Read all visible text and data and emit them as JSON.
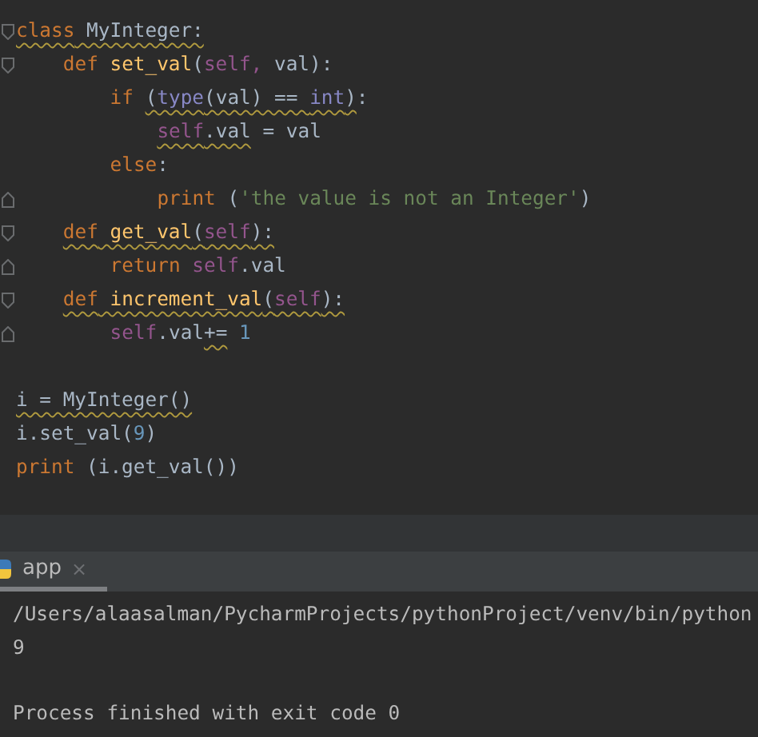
{
  "editor": {
    "lines": [
      {
        "kind": "code",
        "fold_start": true,
        "tokens": [
          {
            "text": "class",
            "kind": "keyword",
            "warning": true
          },
          {
            "text": " MyInteger:",
            "kind": "plain",
            "warning": true
          }
        ],
        "children": [
          {
            "kind": "code",
            "fold_start": true,
            "tokens": [
              {
                "text": "def",
                "kind": "keyword"
              },
              {
                "text": " set_val",
                "kind": "function"
              },
              {
                "text": "(",
                "kind": "plain"
              },
              {
                "text": "self,",
                "kind": "self"
              },
              {
                "text": " val):",
                "kind": "plain"
              }
            ],
            "children": [
              {
                "kind": "code",
                "tokens": [
                  {
                    "text": "if ",
                    "kind": "keyword"
                  },
                  {
                    "text": "(",
                    "kind": "plain",
                    "warning": true
                  },
                  {
                    "text": "type",
                    "kind": "builtin",
                    "warning": true
                  },
                  {
                    "text": "(val) == ",
                    "kind": "plain",
                    "warning": true
                  },
                  {
                    "text": "int",
                    "kind": "builtin",
                    "warning": true
                  },
                  {
                    "text": ")",
                    "kind": "plain",
                    "warning": true
                  },
                  {
                    "text": ":",
                    "kind": "plain"
                  }
                ],
                "children": [
                  {
                    "kind": "code",
                    "tokens": [
                      {
                        "text": "self",
                        "kind": "self",
                        "warning": true
                      },
                      {
                        "text": ".val",
                        "kind": "plain",
                        "warning": true
                      },
                      {
                        "text": " = val",
                        "kind": "plain"
                      }
                    ]
                  }
                ]
              },
              {
                "kind": "code",
                "tokens": [
                  {
                    "text": "else",
                    "kind": "keyword"
                  },
                  {
                    "text": ":",
                    "kind": "plain"
                  }
                ],
                "children": [
                  {
                    "kind": "code",
                    "fold_end": true,
                    "tokens": [
                      {
                        "text": "print",
                        "kind": "keyword"
                      },
                      {
                        "text": " (",
                        "kind": "plain"
                      },
                      {
                        "text": "'the value is not an Integer'",
                        "kind": "string"
                      },
                      {
                        "text": ")",
                        "kind": "plain"
                      }
                    ]
                  }
                ]
              }
            ]
          },
          {
            "kind": "code",
            "fold_start": true,
            "tokens": [
              {
                "text": "def",
                "kind": "keyword",
                "warning": true
              },
              {
                "text": " get_val",
                "kind": "function",
                "warning": true
              },
              {
                "text": "(",
                "kind": "plain",
                "warning": true
              },
              {
                "text": "self",
                "kind": "self",
                "warning": true
              },
              {
                "text": "):",
                "kind": "plain",
                "warning": true
              }
            ],
            "children": [
              {
                "kind": "code",
                "fold_end": true,
                "tokens": [
                  {
                    "text": "return ",
                    "kind": "keyword"
                  },
                  {
                    "text": "self",
                    "kind": "self"
                  },
                  {
                    "text": ".val",
                    "kind": "plain"
                  }
                ]
              }
            ]
          },
          {
            "kind": "code",
            "fold_start": true,
            "tokens": [
              {
                "text": "def",
                "kind": "keyword",
                "warning": true
              },
              {
                "text": " increment_val",
                "kind": "function",
                "warning": true
              },
              {
                "text": "(",
                "kind": "plain",
                "warning": true
              },
              {
                "text": "self",
                "kind": "self",
                "warning": true
              },
              {
                "text": "):",
                "kind": "plain",
                "warning": true
              }
            ],
            "children": [
              {
                "kind": "code",
                "fold_end": true,
                "tokens": [
                  {
                    "text": "self",
                    "kind": "self"
                  },
                  {
                    "text": ".val",
                    "kind": "plain"
                  },
                  {
                    "text": "+=",
                    "kind": "plain",
                    "warning": true
                  },
                  {
                    "text": " 1",
                    "kind": "number"
                  }
                ]
              }
            ]
          }
        ]
      },
      {
        "kind": "blank"
      },
      {
        "kind": "code",
        "tokens": [
          {
            "text": "i = MyInteger()",
            "kind": "plain",
            "warning": true
          }
        ]
      },
      {
        "kind": "code",
        "tokens": [
          {
            "text": "i.set_val(",
            "kind": "plain"
          },
          {
            "text": "9",
            "kind": "number"
          },
          {
            "text": ")",
            "kind": "plain"
          }
        ]
      },
      {
        "kind": "code",
        "tokens": [
          {
            "text": "print",
            "kind": "keyword"
          },
          {
            "text": " (i.get_val())",
            "kind": "plain"
          }
        ]
      }
    ]
  },
  "run_panel": {
    "tabs": [
      {
        "label": "app",
        "close": "×",
        "selected": true
      }
    ],
    "output": [
      {
        "kind": "text",
        "text": "/Users/alaasalman/PycharmProjects/pythonProject/venv/bin/python"
      },
      {
        "kind": "text",
        "text": "9"
      },
      {
        "kind": "blank"
      },
      {
        "kind": "text",
        "text": "Process finished with exit code 0"
      }
    ]
  }
}
